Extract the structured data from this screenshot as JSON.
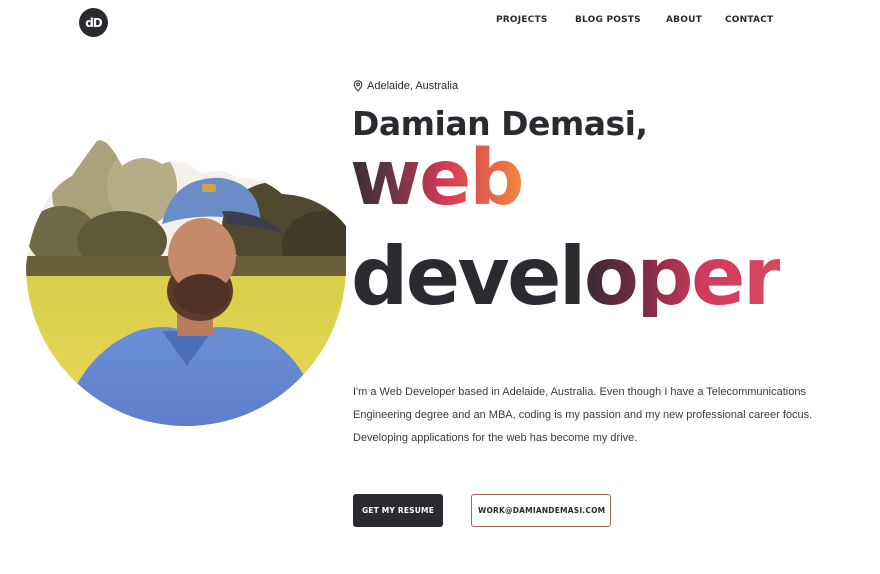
{
  "header": {
    "logo_text": "dD",
    "nav": [
      {
        "label": "PROJECTS"
      },
      {
        "label": "BLOG  POSTS"
      },
      {
        "label": "ABOUT"
      },
      {
        "label": "CONTACT"
      }
    ]
  },
  "hero": {
    "location": "Adelaide, Australia",
    "location_icon": "map-pin-icon",
    "name": "Damian Demasi,",
    "role_line1": "web",
    "role_line2": "developer",
    "bio": [
      "I'm a Web Developer based in Adelaide, Australia. Even though I have a Telecommunications",
      "Engineering degree and an MBA, coding is my passion and my new professional career focus.",
      "Developing applications for the web has become my drive."
    ],
    "primary_button": "GET MY RESUME",
    "secondary_button": "WORK@DAMIANDEMASI.COM"
  },
  "colors": {
    "dark": "#2b2a30",
    "accent_pink": "#d33a56",
    "accent_orange": "#ef8a3f",
    "button_border": "#a06a56"
  }
}
